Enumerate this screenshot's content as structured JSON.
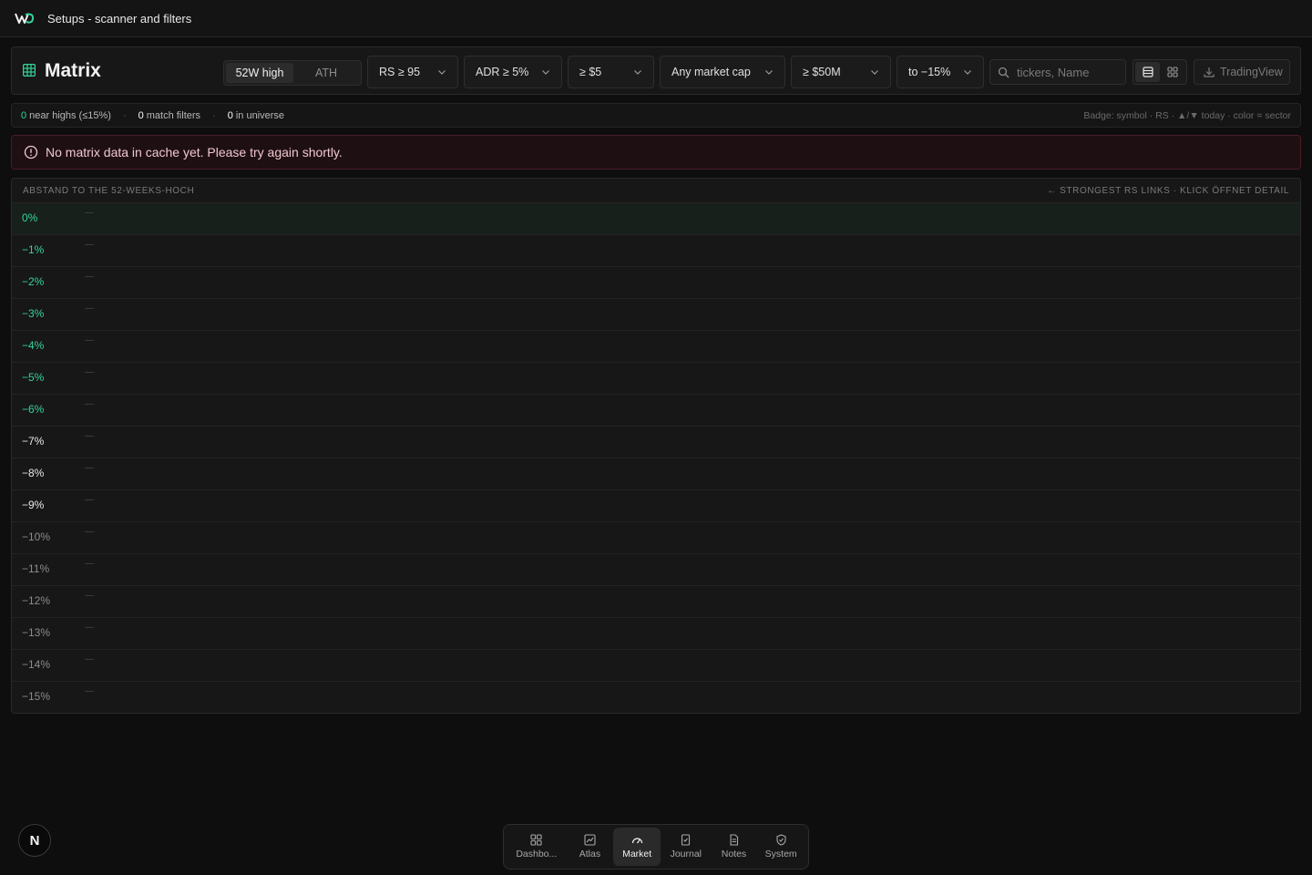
{
  "topbar": {
    "title": "Setups - scanner and filters"
  },
  "header": {
    "title": "Matrix",
    "mode_toggle": {
      "options": [
        "52W high",
        "ATH"
      ],
      "selected": "52W high"
    },
    "filters": {
      "rs": "RS ≥ 95",
      "adr": "ADR ≥ 5%",
      "price": "≥ $5",
      "market_cap": "Any market cap",
      "volume": "≥ $50M",
      "distance": "to −15%"
    },
    "search": {
      "placeholder": "tickers, Name",
      "value": ""
    },
    "export_label": "TradingView"
  },
  "stats": {
    "near_highs_count": "0",
    "near_highs_label": "near highs (≤15%)",
    "match_count": "0",
    "match_label": "match filters",
    "universe_count": "0",
    "universe_label": "in universe",
    "legend": "Badge: symbol · RS · ▲/▼ today · color = sector"
  },
  "alert": {
    "message": "No matrix data in cache yet. Please try again shortly."
  },
  "matrix": {
    "left_header": "ABSTAND TO THE 52-WEEKS-HOCH",
    "right_header": "← STRONGEST RS LINKS · KLICK ÖFFNET DETAIL",
    "empty_marker": "—",
    "rows": [
      "0%",
      "−1%",
      "−2%",
      "−3%",
      "−4%",
      "−5%",
      "−6%",
      "−7%",
      "−8%",
      "−9%",
      "−10%",
      "−11%",
      "−12%",
      "−13%",
      "−14%",
      "−15%"
    ]
  },
  "avatar": {
    "initial": "N"
  },
  "bottom_nav": [
    {
      "label": "Dashbo...",
      "icon": "dashboard-icon"
    },
    {
      "label": "Atlas",
      "icon": "chart-icon"
    },
    {
      "label": "Market",
      "icon": "gauge-icon",
      "active": true
    },
    {
      "label": "Journal",
      "icon": "journal-icon"
    },
    {
      "label": "Notes",
      "icon": "notes-icon"
    },
    {
      "label": "System",
      "icon": "shield-icon"
    }
  ],
  "colors": {
    "accent_green": "#34d399",
    "alert_bg": "#1e0f13",
    "alert_border": "#4a1c26"
  }
}
